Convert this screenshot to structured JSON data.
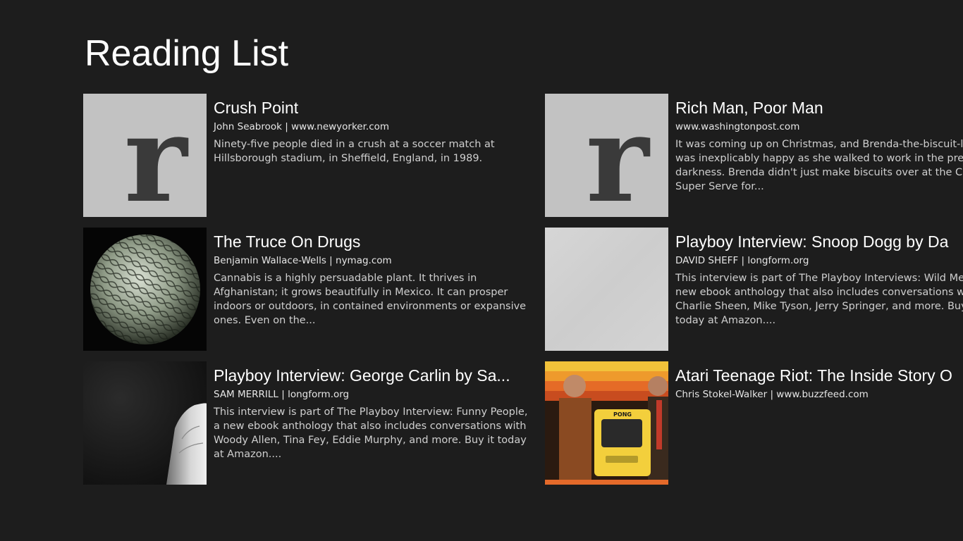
{
  "page": {
    "title": "Reading List"
  },
  "items": [
    {
      "title": "Crush Point",
      "meta": "John Seabrook | www.newyorker.com",
      "summary": "Ninety-five people died in a crush at a soccer match at Hillsborough stadium, in Sheffield, England, in 1989.",
      "thumb_letter": "r"
    },
    {
      "title": "Rich Man, Poor Man",
      "meta": "www.washingtonpost.com",
      "summary_lines": [
        "It was coming up on Christmas, and Brenda-the-biscuit-la",
        "was inexplicably happy as she walked to work in the pred",
        "darkness. Brenda didn't just make biscuits over at the C&",
        "Super Serve for..."
      ],
      "thumb_letter": "r"
    },
    {
      "title": "The Truce On Drugs",
      "meta": "Benjamin Wallace-Wells | nymag.com",
      "summary": "Cannabis is a highly persuadable plant. It thrives in Afghanistan; it grows beautifully in Mexico. It can prosper indoors or outdoors, in contained environments or expansive ones. Even on the..."
    },
    {
      "title": "Playboy Interview: Snoop Dogg by Da",
      "meta": "DAVID SHEFF | longform.org",
      "summary_lines": [
        "This interview is part of The Playboy Interviews: Wild Men",
        "new ebook anthology that also includes conversations wi",
        "Charlie Sheen, Mike Tyson, Jerry Springer, and more. Buy",
        "today at Amazon...."
      ]
    },
    {
      "title": "Playboy Interview: George Carlin by Sa...",
      "meta": "SAM MERRILL | longform.org",
      "summary": "This interview is part of The Playboy Interview: Funny People, a new ebook anthology that also includes conversations with Woody Allen, Tina Fey, Eddie Murphy, and more. Buy it today at Amazon...."
    },
    {
      "title": "Atari Teenage Riot: The Inside Story O",
      "meta": "Chris Stokel-Walker | www.buzzfeed.com",
      "thumb_label": "PONG"
    }
  ],
  "colors": {
    "background": "#1d1d1d",
    "text": "#ffffff",
    "secondary_text": "#cfcfcf",
    "placeholder_thumb": "#c2c2c2"
  }
}
